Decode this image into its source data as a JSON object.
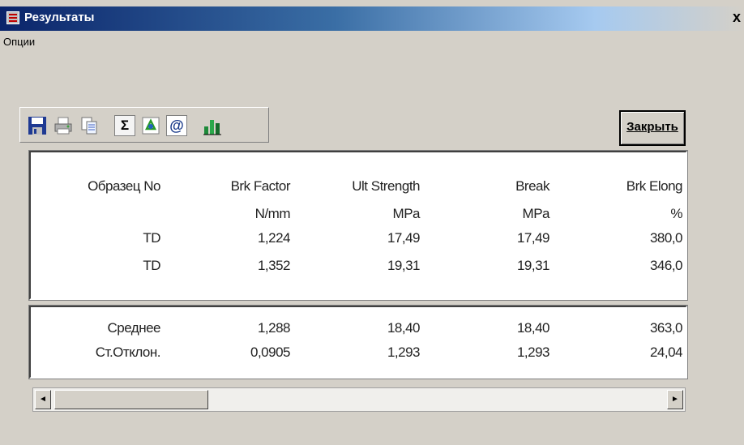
{
  "window": {
    "title": "Результаты",
    "close_glyph": "x"
  },
  "menu": {
    "options_label": "Опции"
  },
  "toolbar": {
    "icons": [
      "save-icon",
      "print-icon",
      "copy-icon",
      "sum-icon",
      "recycle-icon",
      "email-icon",
      "chart-icon"
    ],
    "sum_glyph": "Σ",
    "email_glyph": "@",
    "close_button_label": "Закрыть"
  },
  "table": {
    "headers": [
      "Образец No",
      "Brk Factor",
      "Ult Strength",
      "Break",
      "Brk Elong"
    ],
    "units": [
      "",
      "N/mm",
      "MPa",
      "MPa",
      "%"
    ],
    "rows": [
      [
        "TD",
        "1,224",
        "17,49",
        "17,49",
        "380,0"
      ],
      [
        "TD",
        "1,352",
        "19,31",
        "19,31",
        "346,0"
      ]
    ]
  },
  "stats": {
    "rows": [
      [
        "Среднее",
        "1,288",
        "18,40",
        "18,40",
        "363,0"
      ],
      [
        "Ст.Отклон.",
        "0,0905",
        "1,293",
        "1,293",
        "24,04"
      ]
    ]
  },
  "scrollbar": {
    "left_arrow": "◄",
    "right_arrow": "►"
  }
}
